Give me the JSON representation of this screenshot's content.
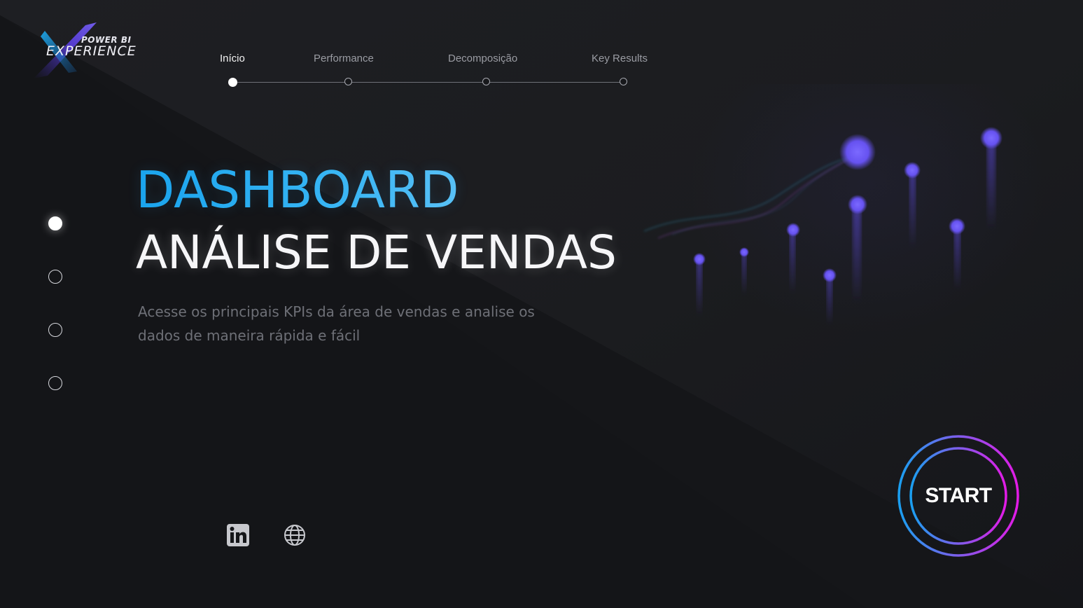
{
  "logo": {
    "line1": "POWER BI",
    "line2": "EXPERIENCE"
  },
  "nav": {
    "steps": [
      {
        "label": "Início",
        "active": true
      },
      {
        "label": "Performance",
        "active": false
      },
      {
        "label": "Decomposição",
        "active": false
      },
      {
        "label": "Key Results",
        "active": false
      }
    ]
  },
  "side_pager": {
    "count": 4,
    "active_index": 0
  },
  "hero": {
    "title": "DASHBOARD",
    "subtitle": "ANÁLISE DE VENDAS",
    "description": "Acesse os principais KPIs da área de vendas e analise os dados de maneira rápida e fácil"
  },
  "social": {
    "icons": [
      "linkedin-icon",
      "globe-icon"
    ]
  },
  "start_button": {
    "label": "START"
  },
  "colors": {
    "title_blue": "#1aa5ee",
    "accent_magenta": "#e21be6",
    "accent_cyan": "#1a9ff0",
    "dot_purple": "#6a55f2"
  }
}
